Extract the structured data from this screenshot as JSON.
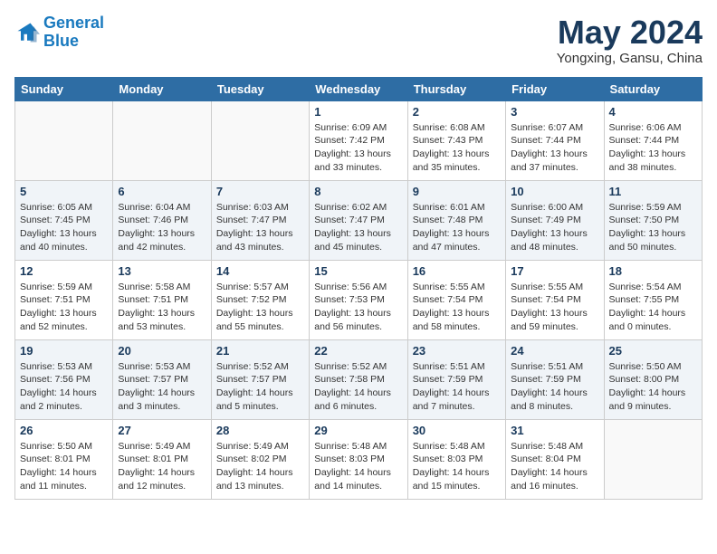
{
  "header": {
    "logo_line1": "General",
    "logo_line2": "Blue",
    "month_year": "May 2024",
    "location": "Yongxing, Gansu, China"
  },
  "days_of_week": [
    "Sunday",
    "Monday",
    "Tuesday",
    "Wednesday",
    "Thursday",
    "Friday",
    "Saturday"
  ],
  "weeks": [
    [
      {
        "day": "",
        "info": ""
      },
      {
        "day": "",
        "info": ""
      },
      {
        "day": "",
        "info": ""
      },
      {
        "day": "1",
        "info": "Sunrise: 6:09 AM\nSunset: 7:42 PM\nDaylight: 13 hours\nand 33 minutes."
      },
      {
        "day": "2",
        "info": "Sunrise: 6:08 AM\nSunset: 7:43 PM\nDaylight: 13 hours\nand 35 minutes."
      },
      {
        "day": "3",
        "info": "Sunrise: 6:07 AM\nSunset: 7:44 PM\nDaylight: 13 hours\nand 37 minutes."
      },
      {
        "day": "4",
        "info": "Sunrise: 6:06 AM\nSunset: 7:44 PM\nDaylight: 13 hours\nand 38 minutes."
      }
    ],
    [
      {
        "day": "5",
        "info": "Sunrise: 6:05 AM\nSunset: 7:45 PM\nDaylight: 13 hours\nand 40 minutes."
      },
      {
        "day": "6",
        "info": "Sunrise: 6:04 AM\nSunset: 7:46 PM\nDaylight: 13 hours\nand 42 minutes."
      },
      {
        "day": "7",
        "info": "Sunrise: 6:03 AM\nSunset: 7:47 PM\nDaylight: 13 hours\nand 43 minutes."
      },
      {
        "day": "8",
        "info": "Sunrise: 6:02 AM\nSunset: 7:47 PM\nDaylight: 13 hours\nand 45 minutes."
      },
      {
        "day": "9",
        "info": "Sunrise: 6:01 AM\nSunset: 7:48 PM\nDaylight: 13 hours\nand 47 minutes."
      },
      {
        "day": "10",
        "info": "Sunrise: 6:00 AM\nSunset: 7:49 PM\nDaylight: 13 hours\nand 48 minutes."
      },
      {
        "day": "11",
        "info": "Sunrise: 5:59 AM\nSunset: 7:50 PM\nDaylight: 13 hours\nand 50 minutes."
      }
    ],
    [
      {
        "day": "12",
        "info": "Sunrise: 5:59 AM\nSunset: 7:51 PM\nDaylight: 13 hours\nand 52 minutes."
      },
      {
        "day": "13",
        "info": "Sunrise: 5:58 AM\nSunset: 7:51 PM\nDaylight: 13 hours\nand 53 minutes."
      },
      {
        "day": "14",
        "info": "Sunrise: 5:57 AM\nSunset: 7:52 PM\nDaylight: 13 hours\nand 55 minutes."
      },
      {
        "day": "15",
        "info": "Sunrise: 5:56 AM\nSunset: 7:53 PM\nDaylight: 13 hours\nand 56 minutes."
      },
      {
        "day": "16",
        "info": "Sunrise: 5:55 AM\nSunset: 7:54 PM\nDaylight: 13 hours\nand 58 minutes."
      },
      {
        "day": "17",
        "info": "Sunrise: 5:55 AM\nSunset: 7:54 PM\nDaylight: 13 hours\nand 59 minutes."
      },
      {
        "day": "18",
        "info": "Sunrise: 5:54 AM\nSunset: 7:55 PM\nDaylight: 14 hours\nand 0 minutes."
      }
    ],
    [
      {
        "day": "19",
        "info": "Sunrise: 5:53 AM\nSunset: 7:56 PM\nDaylight: 14 hours\nand 2 minutes."
      },
      {
        "day": "20",
        "info": "Sunrise: 5:53 AM\nSunset: 7:57 PM\nDaylight: 14 hours\nand 3 minutes."
      },
      {
        "day": "21",
        "info": "Sunrise: 5:52 AM\nSunset: 7:57 PM\nDaylight: 14 hours\nand 5 minutes."
      },
      {
        "day": "22",
        "info": "Sunrise: 5:52 AM\nSunset: 7:58 PM\nDaylight: 14 hours\nand 6 minutes."
      },
      {
        "day": "23",
        "info": "Sunrise: 5:51 AM\nSunset: 7:59 PM\nDaylight: 14 hours\nand 7 minutes."
      },
      {
        "day": "24",
        "info": "Sunrise: 5:51 AM\nSunset: 7:59 PM\nDaylight: 14 hours\nand 8 minutes."
      },
      {
        "day": "25",
        "info": "Sunrise: 5:50 AM\nSunset: 8:00 PM\nDaylight: 14 hours\nand 9 minutes."
      }
    ],
    [
      {
        "day": "26",
        "info": "Sunrise: 5:50 AM\nSunset: 8:01 PM\nDaylight: 14 hours\nand 11 minutes."
      },
      {
        "day": "27",
        "info": "Sunrise: 5:49 AM\nSunset: 8:01 PM\nDaylight: 14 hours\nand 12 minutes."
      },
      {
        "day": "28",
        "info": "Sunrise: 5:49 AM\nSunset: 8:02 PM\nDaylight: 14 hours\nand 13 minutes."
      },
      {
        "day": "29",
        "info": "Sunrise: 5:48 AM\nSunset: 8:03 PM\nDaylight: 14 hours\nand 14 minutes."
      },
      {
        "day": "30",
        "info": "Sunrise: 5:48 AM\nSunset: 8:03 PM\nDaylight: 14 hours\nand 15 minutes."
      },
      {
        "day": "31",
        "info": "Sunrise: 5:48 AM\nSunset: 8:04 PM\nDaylight: 14 hours\nand 16 minutes."
      },
      {
        "day": "",
        "info": ""
      }
    ]
  ]
}
